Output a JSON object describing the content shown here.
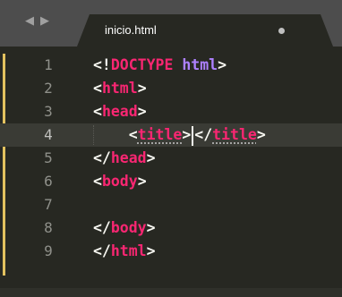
{
  "tabbar": {
    "back_glyph": "◀",
    "forward_glyph": "▶",
    "tab_title": "inicio.html"
  },
  "editor": {
    "current_line": 4,
    "lines": [
      {
        "num": "1",
        "parts": [
          {
            "t": "<!",
            "c": "br"
          },
          {
            "t": "DOCTYPE",
            "c": "tag"
          },
          {
            "t": " ",
            "c": "br"
          },
          {
            "t": "html",
            "c": "kw"
          },
          {
            "t": ">",
            "c": "br"
          }
        ]
      },
      {
        "num": "2",
        "parts": [
          {
            "t": "<",
            "c": "br"
          },
          {
            "t": "html",
            "c": "tag"
          },
          {
            "t": ">",
            "c": "br"
          }
        ]
      },
      {
        "num": "3",
        "parts": [
          {
            "t": "<",
            "c": "br"
          },
          {
            "t": "head",
            "c": "tag"
          },
          {
            "t": ">",
            "c": "br"
          }
        ]
      },
      {
        "num": "4",
        "parts": [
          {
            "t": "    <",
            "c": "br"
          },
          {
            "t": "title",
            "c": "tag m"
          },
          {
            "t": ">",
            "c": "br"
          },
          {
            "t": "",
            "c": "cursor"
          },
          {
            "t": "</",
            "c": "br"
          },
          {
            "t": "title",
            "c": "tag m"
          },
          {
            "t": ">",
            "c": "br"
          }
        ]
      },
      {
        "num": "5",
        "parts": [
          {
            "t": "</",
            "c": "br"
          },
          {
            "t": "head",
            "c": "tag"
          },
          {
            "t": ">",
            "c": "br"
          }
        ]
      },
      {
        "num": "6",
        "parts": [
          {
            "t": "<",
            "c": "br"
          },
          {
            "t": "body",
            "c": "tag"
          },
          {
            "t": ">",
            "c": "br"
          }
        ]
      },
      {
        "num": "7",
        "parts": []
      },
      {
        "num": "8",
        "parts": [
          {
            "t": "</",
            "c": "br"
          },
          {
            "t": "body",
            "c": "tag"
          },
          {
            "t": ">",
            "c": "br"
          }
        ]
      },
      {
        "num": "9",
        "parts": [
          {
            "t": "</",
            "c": "br"
          },
          {
            "t": "html",
            "c": "tag"
          },
          {
            "t": ">",
            "c": "br"
          }
        ]
      }
    ]
  },
  "colors": {
    "background": "#272822",
    "tabbar": "#4d4d4d",
    "tag": "#f92672",
    "keyword": "#ae81ff",
    "bracket": "#f8f8f2",
    "line_number": "#8f908a",
    "modified_marker": "#e3c25f"
  }
}
